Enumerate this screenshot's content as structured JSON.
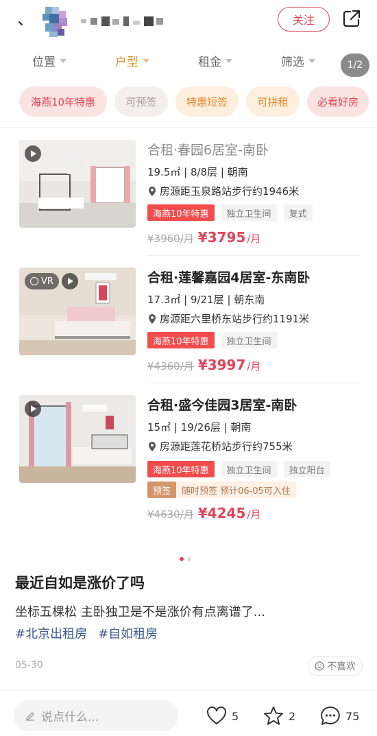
{
  "header": {
    "follow_label": "关注"
  },
  "filters": [
    {
      "label": "位置",
      "active": false
    },
    {
      "label": "户型",
      "active": true
    },
    {
      "label": "租金",
      "active": false
    },
    {
      "label": "筛选",
      "active": false
    }
  ],
  "page_indicator": "1/2",
  "chips": [
    "海燕10年特惠",
    "可预签",
    "特惠短签",
    "可拼租",
    "必看好房"
  ],
  "listings": [
    {
      "title": "合租·春园6居室-南卧",
      "meta": "19.5㎡ | 8/8层 | 朝南",
      "location": "房源距玉泉路站步行约1946米",
      "tags": [
        "海燕10年特惠",
        "独立卫生间",
        "复式"
      ],
      "old_price": "¥3960/月",
      "new_price": "¥3795",
      "price_unit": "/月",
      "media": "play-icon"
    },
    {
      "title": "合租·莲馨嘉园4居室-东南卧",
      "meta": "17.3㎡ | 9/21层 | 朝东南",
      "location": "房源距六里桥东站步行约1191米",
      "tags": [
        "海燕10年特惠",
        "独立卫生间"
      ],
      "old_price": "¥4360/月",
      "new_price": "¥3997",
      "price_unit": "/月",
      "vr_label": "VR",
      "media": "play-icon"
    },
    {
      "title": "合租·盛今佳园3居室-南卧",
      "meta": "15㎡ | 19/26层 | 朝南",
      "location": "房源距莲花桥站步行约755米",
      "tags": [
        "海燕10年特惠",
        "独立卫生间",
        "独立阳台"
      ],
      "presign_label": "预签",
      "presign_info": "随时预签 预计06-05可入住",
      "old_price": "¥4630/月",
      "new_price": "¥4245",
      "price_unit": "/月",
      "media": "play-icon"
    }
  ],
  "post": {
    "title": "最近自如是涨价了吗",
    "body": "坐标五棵松 主卧独卫是不是涨价有点离谱了...",
    "hashtags": [
      "#北京出租房",
      "#自如租房"
    ],
    "date": "05-30",
    "dislike_label": "不喜欢"
  },
  "bottom_bar": {
    "comment_placeholder": "说点什么...",
    "likes": "5",
    "favorites": "2",
    "comments": "75"
  },
  "colors": {
    "accent": "#e0455a",
    "filter_active": "#d9962c",
    "promo_tag": "#f04c4c",
    "hashtag": "#3a5a8c"
  }
}
